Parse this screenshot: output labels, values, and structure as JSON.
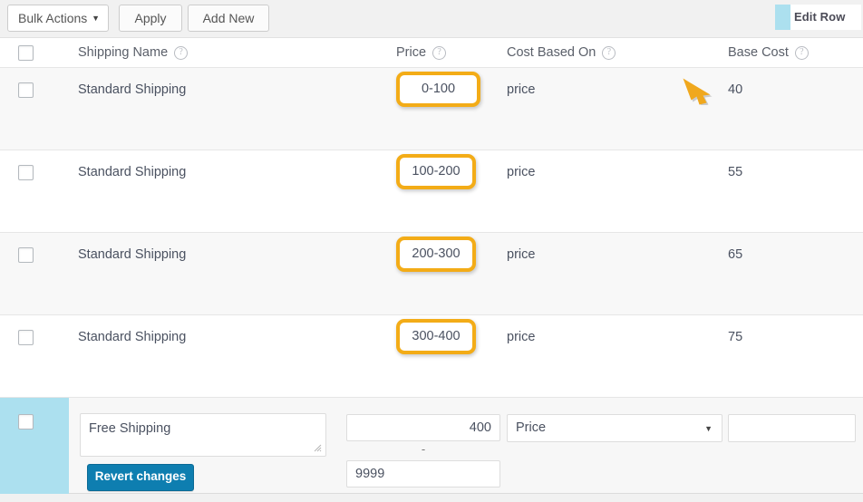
{
  "toolbar": {
    "bulk_actions_label": "Bulk Actions",
    "bulk_actions_caret": "▼",
    "apply_label": "Apply",
    "add_new_label": "Add New",
    "edit_row_tab_label": "Edit Row",
    "edit_row_swatch_color": "#ace0ef"
  },
  "table": {
    "columns": [
      {
        "key": "select",
        "label": "",
        "help": false
      },
      {
        "key": "name",
        "label": "Shipping Name",
        "help": true
      },
      {
        "key": "price",
        "label": "Price",
        "help": true
      },
      {
        "key": "cost_on",
        "label": "Cost Based On",
        "help": true
      },
      {
        "key": "base",
        "label": "Base Cost",
        "help": true
      }
    ],
    "help_glyph": "?",
    "rows": [
      {
        "name": "Standard Shipping",
        "price": "0-100",
        "cost_based_on": "price",
        "base_cost": "40",
        "price_highlighted": true,
        "shaded": true
      },
      {
        "name": "Standard Shipping",
        "price": "100-200",
        "cost_based_on": "price",
        "base_cost": "55",
        "price_highlighted": true,
        "shaded": false
      },
      {
        "name": "Standard Shipping",
        "price": "200-300",
        "cost_based_on": "price",
        "base_cost": "65",
        "price_highlighted": true,
        "shaded": true
      },
      {
        "name": "Standard Shipping",
        "price": "300-400",
        "cost_based_on": "price",
        "base_cost": "75",
        "price_highlighted": true,
        "shaded": false
      }
    ]
  },
  "edit_row": {
    "shipping_name_value": "Free Shipping",
    "price_max_value": "400",
    "range_separator": "-",
    "price_min_value": "9999",
    "cost_based_on_value": "Price",
    "cost_based_on_caret": "▼",
    "base_cost_value": "",
    "revert_label": "Revert changes"
  },
  "annotation": {
    "arrow_color": "#f0a81e",
    "points_at": "40"
  },
  "colors": {
    "highlight_border": "#f3ac17",
    "button_blue": "#0e7eb0",
    "row_shade": "#f8f8f8",
    "page_bg": "#f1f1f1"
  }
}
